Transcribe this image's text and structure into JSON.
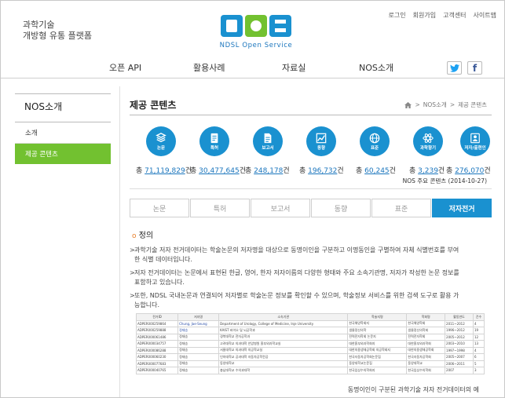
{
  "header": {
    "site_title_line1": "과학기술",
    "site_title_line2": "개방형 유통 플랫폼",
    "logo_text": "NOS",
    "logo_sub": "NDSL Open Service",
    "utils": [
      "로그인",
      "회원가입",
      "고객센터",
      "사이트맵"
    ]
  },
  "gnb": {
    "items": [
      "오픈 API",
      "활용사례",
      "자료실",
      "NOS소개"
    ],
    "twitter": "t",
    "facebook": "f"
  },
  "lnb": {
    "title": "NOS소개",
    "items": [
      "소개",
      "제공 콘텐츠"
    ]
  },
  "page": {
    "title": "제공 콘텐츠",
    "breadcrumb": [
      "NOS소개",
      "제공 콘텐츠"
    ],
    "breadcrumb_sep": ">"
  },
  "stats": [
    {
      "label": "논문",
      "prefix": "총",
      "count": "71,119,829",
      "suffix": "건"
    },
    {
      "label": "특허",
      "prefix": "총",
      "count": "30,477,645",
      "suffix": "건"
    },
    {
      "label": "보고서",
      "prefix": "총",
      "count": "248,178",
      "suffix": "건"
    },
    {
      "label": "동향",
      "prefix": "총",
      "count": "196,732",
      "suffix": "건"
    },
    {
      "label": "표준",
      "prefix": "총",
      "count": "60,245",
      "suffix": "건"
    },
    {
      "label": "과학향기",
      "prefix": "총",
      "count": "3,239",
      "suffix": "건"
    },
    {
      "label": "저자/출현인",
      "prefix": "총",
      "count": "276,070",
      "suffix": "건"
    }
  ],
  "nos_note": "NOS 주요 콘텐츠 (2014-10-27)",
  "tabs": [
    "논문",
    "특허",
    "보고서",
    "동향",
    "표준",
    "저자전거"
  ],
  "section": {
    "bullet": "o",
    "title": "정의"
  },
  "paragraphs": [
    {
      "line1": "과학기술 저자 전거데이터는 학술논문의 저자명을 대상으로 동명이인을 구분하고 이명동인을 구별하여 자체 식별번호를 부여",
      "line2": "한 식별 데이터입니다."
    },
    {
      "line1": "저자 전거데이터는 논문에서 표현된 한글, 영어, 한자 저자이름의 다양한 형태와 주요 소속기관명, 저자가 작성한 논문 정보를",
      "line2": "표함하고 있습니다."
    },
    {
      "line1": "또한, NDSL 국내논문과 연결되어 저자별로 학술논문 정보를 확인할 수 있으며, 학술정보 서비스를 위한 검색 도구로 활용 가",
      "line2": "능합니다."
    }
  ],
  "para_bullet": ">",
  "table": {
    "headers": [
      "전거ID",
      "저자명",
      "소속기관",
      "학술지명",
      "학회명",
      "활동연도",
      "건수"
    ],
    "rows": [
      [
        "ADPER000259864",
        "Chung, Jae-Seung",
        "Department of Urology, College of Medicine, Inje University",
        "한국해양학회지",
        "한국해양학회",
        "2011~2012",
        "4"
      ],
      [
        "ADPER000259888",
        "정재승",
        "KAIST 바이오 및 뇌공학과",
        "생물정신의학",
        "생물정신의학회",
        "1996~2012",
        "19"
      ],
      [
        "ADPER000061486",
        "정재승",
        "경북대학교 전자공학과",
        "전력전자학회 논문지",
        "전력전자학회",
        "2005~2012",
        "12"
      ],
      [
        "ADPER000034757",
        "정재승",
        "고려대학교 의과대학 안암병원 흉부외과학교실",
        "대한흉부외과학회지",
        "대한흉부외과학회",
        "2003~2010",
        "13"
      ],
      [
        "ADPER000086288",
        "정재승",
        "서울대학교 의과대학 의공학교실",
        "대한의용생체공학회 의공학회지",
        "대한의용생체공학회",
        "1997~1998",
        "4"
      ],
      [
        "ADPER000060230",
        "정재승",
        "인하대학교 공과대학 자동차공학전공",
        "한국자동차공학회논문집",
        "한국자동차공학회",
        "2005~2007",
        "6"
      ],
      [
        "ADPER000077683",
        "정재승",
        "동양대학교",
        "동양대학교논문집",
        "동양대학교",
        "2006~2011",
        "5"
      ],
      [
        "ADPER000040765",
        "정재승",
        "충남대학교 수의과대학",
        "한국임상수의학회지",
        "한국임상수의학회",
        "2007",
        "3"
      ]
    ]
  },
  "caption": "동명이인이 구분된 과학기술 저자 전거데이터의 예",
  "colors": {
    "accent_blue": "#1a91d0",
    "accent_green": "#72c130",
    "link": "#1a75bd",
    "bullet": "#e8802c"
  }
}
